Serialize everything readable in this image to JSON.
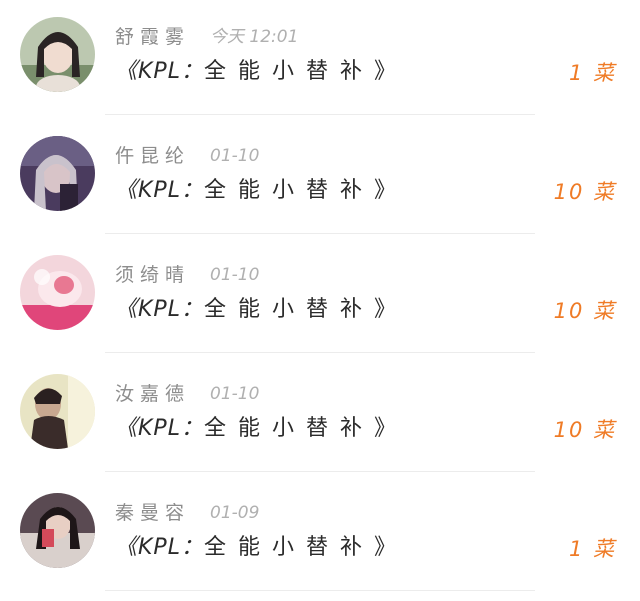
{
  "items": [
    {
      "name": "舒霞雾",
      "time": "今天 12:01",
      "title_prefix": "《KPL：",
      "title_main": "全能小替补",
      "title_suffix": "》",
      "price": "1 菜"
    },
    {
      "name": "仵昆纶",
      "time": "01-10",
      "title_prefix": "《KPL：",
      "title_main": "全能小替补",
      "title_suffix": "》",
      "price": "10 菜"
    },
    {
      "name": "须绮晴",
      "time": "01-10",
      "title_prefix": "《KPL：",
      "title_main": "全能小替补",
      "title_suffix": "》",
      "price": "10 菜"
    },
    {
      "name": "汝嘉德",
      "time": "01-10",
      "title_prefix": "《KPL：",
      "title_main": "全能小替补",
      "title_suffix": "》",
      "price": "10 菜"
    },
    {
      "name": "秦曼容",
      "time": "01-09",
      "title_prefix": "《KPL：",
      "title_main": "全能小替补",
      "title_suffix": "》",
      "price": "1 菜"
    }
  ],
  "colors": {
    "price": "#ef7b26",
    "name": "#8d8d8d",
    "time": "#b0b0b0",
    "title": "#2b2b2b",
    "divider": "#ececec"
  }
}
